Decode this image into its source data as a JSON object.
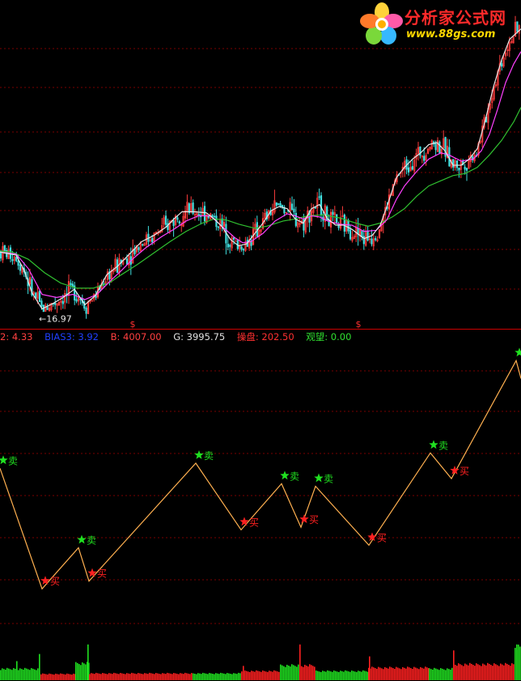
{
  "logo": {
    "title": "分析家公式网",
    "url": "www.88gs.com"
  },
  "status_line": {
    "item0_value": "2: 4.33",
    "bias3_label": "BIAS3:",
    "bias3_value": "3.92",
    "b_label": "B:",
    "b_value": "4007.00",
    "g_label": "G:",
    "g_value": "3995.75",
    "caopan_label": "操盘:",
    "caopan_value": "202.50",
    "guanwang_label": "观望:",
    "guanwang_value": "0.00"
  },
  "colors": {
    "background": "#000000",
    "grid": "#7a0000",
    "divider": "#cc0000",
    "up_candle": "#ff3c3c",
    "down_candle": "#40e0e0",
    "ma_short": "#e8e8e8",
    "ma_mid": "#ff40ff",
    "ma_long": "#30c030",
    "signal_line": "#ffb050",
    "sell": "#20e020",
    "buy": "#ff2020",
    "bias3": "#2040ff",
    "b_label": "#ff4040",
    "g_label": "#e0e0e0",
    "caopan": "#ff3030",
    "guanwang": "#30e030"
  },
  "chart_data": [
    {
      "type": "candlestick",
      "title": "",
      "price_annotations": [
        {
          "text": "←16.97",
          "x": 52,
          "y": 16.97
        }
      ],
      "markers": [
        {
          "text": "$",
          "x": 164
        },
        {
          "text": "$",
          "x": 443
        }
      ],
      "ma_short": [
        [
          0,
          22.8
        ],
        [
          20,
          22.5
        ],
        [
          30,
          21
        ],
        [
          40,
          18.8
        ],
        [
          52,
          17.3
        ],
        [
          65,
          17.8
        ],
        [
          78,
          18.4
        ],
        [
          92,
          19.2
        ],
        [
          105,
          17.7
        ],
        [
          118,
          18.6
        ],
        [
          132,
          20.6
        ],
        [
          145,
          21.4
        ],
        [
          160,
          22.6
        ],
        [
          175,
          23.8
        ],
        [
          190,
          24.4
        ],
        [
          205,
          25.2
        ],
        [
          215,
          26
        ],
        [
          225,
          26.7
        ],
        [
          240,
          26.7
        ],
        [
          255,
          26.6
        ],
        [
          265,
          26
        ],
        [
          275,
          25.2
        ],
        [
          285,
          24
        ],
        [
          295,
          23.4
        ],
        [
          305,
          23.6
        ],
        [
          315,
          24.6
        ],
        [
          325,
          25.6
        ],
        [
          335,
          26.8
        ],
        [
          345,
          27.2
        ],
        [
          355,
          27
        ],
        [
          365,
          26
        ],
        [
          375,
          25.6
        ],
        [
          385,
          27
        ],
        [
          395,
          27.4
        ],
        [
          405,
          26
        ],
        [
          415,
          25.4
        ],
        [
          425,
          25.4
        ],
        [
          435,
          25
        ],
        [
          450,
          24.1
        ],
        [
          460,
          24.4
        ],
        [
          470,
          25.4
        ],
        [
          480,
          27.6
        ],
        [
          490,
          30
        ],
        [
          500,
          31
        ],
        [
          510,
          31.8
        ],
        [
          520,
          32.4
        ],
        [
          530,
          33.2
        ],
        [
          540,
          33.4
        ],
        [
          550,
          32.6
        ],
        [
          560,
          31.2
        ],
        [
          570,
          31.2
        ],
        [
          580,
          31.8
        ],
        [
          590,
          32.8
        ],
        [
          600,
          35.6
        ],
        [
          610,
          38.8
        ],
        [
          620,
          41.4
        ],
        [
          630,
          43.4
        ],
        [
          644,
          44.4
        ]
      ],
      "ma_mid": [
        [
          0,
          22.8
        ],
        [
          20,
          22.6
        ],
        [
          35,
          21.2
        ],
        [
          52,
          18.7
        ],
        [
          70,
          18.4
        ],
        [
          90,
          18.7
        ],
        [
          105,
          18.2
        ],
        [
          120,
          18.7
        ],
        [
          135,
          19.9
        ],
        [
          150,
          21
        ],
        [
          165,
          22.2
        ],
        [
          180,
          23.2
        ],
        [
          200,
          24.3
        ],
        [
          215,
          25
        ],
        [
          230,
          25.8
        ],
        [
          245,
          26.3
        ],
        [
          260,
          26.3
        ],
        [
          270,
          25.6
        ],
        [
          280,
          24.9
        ],
        [
          290,
          24.2
        ],
        [
          300,
          23.7
        ],
        [
          310,
          23.8
        ],
        [
          325,
          24.6
        ],
        [
          340,
          25.8
        ],
        [
          355,
          26.5
        ],
        [
          365,
          26.3
        ],
        [
          375,
          26
        ],
        [
          385,
          26.3
        ],
        [
          395,
          26.2
        ],
        [
          405,
          25.8
        ],
        [
          420,
          25.5
        ],
        [
          435,
          25.4
        ],
        [
          450,
          24.8
        ],
        [
          465,
          24.9
        ],
        [
          478,
          25.9
        ],
        [
          490,
          27.9
        ],
        [
          500,
          29.2
        ],
        [
          515,
          30.6
        ],
        [
          530,
          31.8
        ],
        [
          545,
          32.4
        ],
        [
          555,
          32.2
        ],
        [
          570,
          31.6
        ],
        [
          585,
          31.8
        ],
        [
          595,
          32.6
        ],
        [
          605,
          34.2
        ],
        [
          615,
          36.6
        ],
        [
          625,
          39.2
        ],
        [
          635,
          41
        ],
        [
          644,
          42.2
        ]
      ],
      "ma_long": [
        [
          0,
          22.9
        ],
        [
          15,
          22.8
        ],
        [
          35,
          22.1
        ],
        [
          55,
          20.8
        ],
        [
          75,
          19.8
        ],
        [
          95,
          19.3
        ],
        [
          115,
          19.3
        ],
        [
          135,
          19.8
        ],
        [
          150,
          20.6
        ],
        [
          170,
          21.6
        ],
        [
          190,
          22.7
        ],
        [
          210,
          23.8
        ],
        [
          230,
          24.8
        ],
        [
          250,
          25.6
        ],
        [
          265,
          26
        ],
        [
          280,
          25.9
        ],
        [
          295,
          25.5
        ],
        [
          315,
          25.1
        ],
        [
          330,
          25.3
        ],
        [
          350,
          25.8
        ],
        [
          365,
          26
        ],
        [
          380,
          26.3
        ],
        [
          400,
          26.4
        ],
        [
          420,
          26.1
        ],
        [
          440,
          25.6
        ],
        [
          455,
          25.3
        ],
        [
          470,
          25.6
        ],
        [
          485,
          26.2
        ],
        [
          500,
          27
        ],
        [
          515,
          28.2
        ],
        [
          530,
          29.2
        ],
        [
          545,
          29.7
        ],
        [
          560,
          30.2
        ],
        [
          575,
          30.4
        ],
        [
          590,
          31
        ],
        [
          605,
          32.2
        ],
        [
          620,
          33.6
        ],
        [
          635,
          35.4
        ],
        [
          644,
          36.8
        ]
      ],
      "ylim": [
        16,
        45
      ],
      "xlim": [
        0,
        644
      ]
    },
    {
      "type": "line",
      "title": "",
      "x": [
        0,
        52,
        97,
        110,
        242,
        298,
        348,
        372,
        390,
        456,
        532,
        558,
        638,
        644
      ],
      "values": [
        3920,
        3826,
        3858,
        3832,
        3924,
        3872,
        3908,
        3874,
        3906,
        3860,
        3932,
        3912,
        4004,
        3990
      ],
      "signals": [
        {
          "type": "sell",
          "text": "卖",
          "x": 0,
          "y": 3920
        },
        {
          "type": "buy",
          "text": "买",
          "x": 52,
          "y": 3826
        },
        {
          "type": "sell",
          "text": "卖",
          "x": 97,
          "y": 3858
        },
        {
          "type": "buy",
          "text": "买",
          "x": 110,
          "y": 3832
        },
        {
          "type": "sell",
          "text": "卖",
          "x": 242,
          "y": 3924
        },
        {
          "type": "buy",
          "text": "买",
          "x": 298,
          "y": 3872
        },
        {
          "type": "sell",
          "text": "卖",
          "x": 348,
          "y": 3908
        },
        {
          "type": "buy",
          "text": "买",
          "x": 372,
          "y": 3874
        },
        {
          "type": "sell",
          "text": "卖",
          "x": 390,
          "y": 3906
        },
        {
          "type": "buy",
          "text": "买",
          "x": 456,
          "y": 3860
        },
        {
          "type": "sell",
          "text": "卖",
          "x": 532,
          "y": 3932
        },
        {
          "type": "buy",
          "text": "买",
          "x": 558,
          "y": 3912
        },
        {
          "type": "sell",
          "text": "卖",
          "x": 638,
          "y": 4004
        }
      ],
      "ylim": [
        3780,
        4020
      ]
    },
    {
      "type": "bar",
      "title": "",
      "segments": [
        {
          "from": 0,
          "to": 48,
          "color": "green",
          "value": 1.0
        },
        {
          "from": 48,
          "to": 93,
          "color": "red",
          "value": 0.55
        },
        {
          "from": 93,
          "to": 110,
          "color": "green",
          "value": 1.5
        },
        {
          "from": 110,
          "to": 238,
          "color": "red",
          "value": 0.6
        },
        {
          "from": 238,
          "to": 298,
          "color": "green",
          "value": 0.6
        },
        {
          "from": 298,
          "to": 346,
          "color": "red",
          "value": 0.8
        },
        {
          "from": 346,
          "to": 370,
          "color": "green",
          "value": 1.3
        },
        {
          "from": 370,
          "to": 390,
          "color": "red",
          "value": 1.3
        },
        {
          "from": 390,
          "to": 455,
          "color": "green",
          "value": 0.8
        },
        {
          "from": 455,
          "to": 530,
          "color": "red",
          "value": 1.1
        },
        {
          "from": 530,
          "to": 560,
          "color": "green",
          "value": 1.0
        },
        {
          "from": 560,
          "to": 636,
          "color": "red",
          "value": 1.4
        },
        {
          "from": 636,
          "to": 644,
          "color": "green",
          "value": 3.0
        }
      ],
      "spikes": [
        {
          "x": 20,
          "color": "green",
          "value": 1.6
        },
        {
          "x": 48,
          "color": "green",
          "value": 2.2
        },
        {
          "x": 108,
          "color": "green",
          "value": 3.0
        },
        {
          "x": 300,
          "color": "red",
          "value": 1.2
        },
        {
          "x": 370,
          "color": "red",
          "value": 3.0
        },
        {
          "x": 456,
          "color": "red",
          "value": 2.0
        },
        {
          "x": 560,
          "color": "red",
          "value": 2.5
        },
        {
          "x": 638,
          "color": "green",
          "value": 3.0
        }
      ],
      "ylim": [
        0,
        3.4
      ]
    }
  ]
}
